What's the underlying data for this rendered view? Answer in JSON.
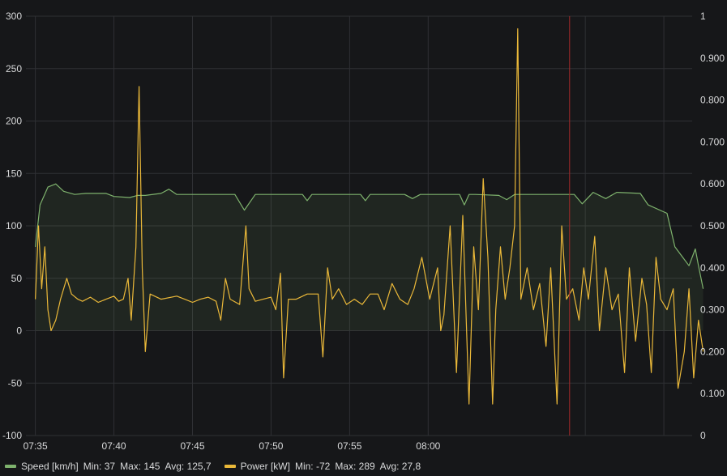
{
  "chart_data": {
    "type": "line",
    "title": "",
    "xlabel": "",
    "ylabel": "",
    "x_ticks": [
      "07:35",
      "07:40",
      "07:45",
      "07:50",
      "07:55",
      "08:00"
    ],
    "x_range_minutes": [
      -0.6,
      41.8
    ],
    "y_left": {
      "ylim": [
        -100,
        300
      ],
      "ticks": [
        "-100",
        "-50",
        "0",
        "50",
        "100",
        "150",
        "200",
        "250",
        "300"
      ]
    },
    "y_right": {
      "ylim": [
        0,
        1
      ],
      "ticks": [
        "0",
        "0.100",
        "0.200",
        "0.300",
        "0.400",
        "0.500",
        "0.600",
        "0.700",
        "0.800",
        "0.900",
        "1"
      ]
    },
    "grid": true,
    "annotation_marker_time": "08:09",
    "series": [
      {
        "name": "Speed [km/h]",
        "color": "#7eb26d",
        "fill": true,
        "axis": "left",
        "stats": {
          "min": "Min: 37",
          "max": "Max: 145",
          "avg": "Avg: 125,7"
        },
        "points": [
          [
            0,
            80
          ],
          [
            0.3,
            120
          ],
          [
            0.8,
            137
          ],
          [
            1.3,
            140
          ],
          [
            1.8,
            133
          ],
          [
            2.5,
            130
          ],
          [
            3.2,
            131
          ],
          [
            4.5,
            131
          ],
          [
            5,
            128
          ],
          [
            6,
            127
          ],
          [
            6.5,
            129
          ],
          [
            7,
            129
          ],
          [
            8,
            131
          ],
          [
            8.5,
            135
          ],
          [
            9,
            130
          ],
          [
            10,
            130
          ],
          [
            12,
            130
          ],
          [
            12.7,
            130
          ],
          [
            13.3,
            115
          ],
          [
            14,
            130
          ],
          [
            17,
            130
          ],
          [
            17.3,
            124
          ],
          [
            17.6,
            130
          ],
          [
            20.7,
            130
          ],
          [
            21,
            124
          ],
          [
            21.3,
            130
          ],
          [
            23.5,
            130
          ],
          [
            24,
            126
          ],
          [
            24.5,
            130
          ],
          [
            27,
            130
          ],
          [
            27.3,
            120
          ],
          [
            27.6,
            130
          ],
          [
            28,
            130
          ],
          [
            29.5,
            129
          ],
          [
            30,
            125
          ],
          [
            30.5,
            130
          ],
          [
            34.3,
            130
          ],
          [
            34.8,
            121
          ],
          [
            35.5,
            132
          ],
          [
            36.3,
            126
          ],
          [
            37,
            132
          ],
          [
            38.5,
            131
          ],
          [
            39,
            120
          ],
          [
            40.2,
            112
          ],
          [
            40.7,
            80
          ],
          [
            41.2,
            70
          ],
          [
            41.6,
            62
          ],
          [
            42,
            78
          ],
          [
            42.2,
            62
          ],
          [
            42.5,
            40
          ]
        ]
      },
      {
        "name": "Power [kW]",
        "color": "#eab839",
        "fill": false,
        "axis": "left",
        "stats": {
          "min": "Min: -72",
          "max": "Max: 289",
          "avg": "Avg: 27,8"
        },
        "points": [
          [
            0,
            30
          ],
          [
            0.2,
            100
          ],
          [
            0.4,
            40
          ],
          [
            0.6,
            80
          ],
          [
            0.8,
            20
          ],
          [
            1,
            0
          ],
          [
            1.3,
            10
          ],
          [
            1.6,
            30
          ],
          [
            2,
            50
          ],
          [
            2.3,
            35
          ],
          [
            2.7,
            30
          ],
          [
            3,
            28
          ],
          [
            3.5,
            32
          ],
          [
            4,
            27
          ],
          [
            4.5,
            30
          ],
          [
            5,
            33
          ],
          [
            5.3,
            28
          ],
          [
            5.6,
            30
          ],
          [
            5.9,
            50
          ],
          [
            6.1,
            10
          ],
          [
            6.4,
            80
          ],
          [
            6.6,
            233
          ],
          [
            6.8,
            60
          ],
          [
            7,
            -20
          ],
          [
            7.3,
            35
          ],
          [
            8,
            30
          ],
          [
            9,
            33
          ],
          [
            9.5,
            30
          ],
          [
            10,
            27
          ],
          [
            10.5,
            30
          ],
          [
            11,
            32
          ],
          [
            11.5,
            28
          ],
          [
            11.8,
            10
          ],
          [
            12.1,
            50
          ],
          [
            12.4,
            30
          ],
          [
            13,
            25
          ],
          [
            13.4,
            100
          ],
          [
            13.6,
            40
          ],
          [
            14,
            28
          ],
          [
            14.5,
            30
          ],
          [
            15,
            32
          ],
          [
            15.3,
            20
          ],
          [
            15.6,
            55
          ],
          [
            15.8,
            -45
          ],
          [
            16.1,
            30
          ],
          [
            16.6,
            30
          ],
          [
            17.3,
            35
          ],
          [
            18,
            35
          ],
          [
            18.3,
            -25
          ],
          [
            18.6,
            60
          ],
          [
            18.9,
            30
          ],
          [
            19.3,
            40
          ],
          [
            19.8,
            25
          ],
          [
            20.3,
            30
          ],
          [
            20.8,
            25
          ],
          [
            21.3,
            35
          ],
          [
            21.8,
            35
          ],
          [
            22.2,
            20
          ],
          [
            22.7,
            45
          ],
          [
            23.2,
            30
          ],
          [
            23.7,
            25
          ],
          [
            24.1,
            40
          ],
          [
            24.6,
            70
          ],
          [
            25.1,
            30
          ],
          [
            25.6,
            60
          ],
          [
            25.8,
            0
          ],
          [
            26,
            15
          ],
          [
            26.4,
            100
          ],
          [
            26.8,
            -40
          ],
          [
            27.2,
            110
          ],
          [
            27.6,
            -70
          ],
          [
            27.9,
            80
          ],
          [
            28.2,
            20
          ],
          [
            28.5,
            145
          ],
          [
            28.8,
            70
          ],
          [
            29.1,
            -70
          ],
          [
            29.3,
            20
          ],
          [
            29.6,
            80
          ],
          [
            29.9,
            30
          ],
          [
            30.2,
            60
          ],
          [
            30.5,
            100
          ],
          [
            30.7,
            288
          ],
          [
            30.9,
            30
          ],
          [
            31.3,
            60
          ],
          [
            31.7,
            20
          ],
          [
            32.1,
            45
          ],
          [
            32.5,
            -15
          ],
          [
            32.8,
            60
          ],
          [
            33.2,
            -70
          ],
          [
            33.5,
            100
          ],
          [
            33.8,
            30
          ],
          [
            34.2,
            40
          ],
          [
            34.6,
            10
          ],
          [
            34.9,
            60
          ],
          [
            35.2,
            30
          ],
          [
            35.6,
            90
          ],
          [
            35.9,
            0
          ],
          [
            36.3,
            60
          ],
          [
            36.7,
            20
          ],
          [
            37.1,
            35
          ],
          [
            37.5,
            -40
          ],
          [
            37.8,
            60
          ],
          [
            38.2,
            -10
          ],
          [
            38.6,
            50
          ],
          [
            38.9,
            25
          ],
          [
            39.2,
            -40
          ],
          [
            39.5,
            70
          ],
          [
            39.8,
            30
          ],
          [
            40.2,
            20
          ],
          [
            40.6,
            40
          ],
          [
            40.9,
            -55
          ],
          [
            41.3,
            -20
          ],
          [
            41.6,
            40
          ],
          [
            41.9,
            -45
          ],
          [
            42.2,
            10
          ],
          [
            42.5,
            -20
          ]
        ]
      }
    ]
  }
}
